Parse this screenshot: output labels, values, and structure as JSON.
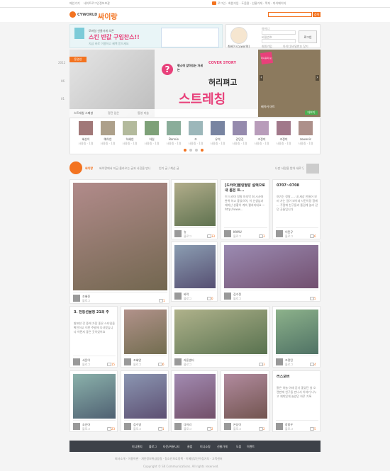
{
  "topbar": {
    "left_links": [
      "메인가기",
      "네이트로그인정보보관"
    ],
    "right_text": "로그인 · 회원가입 · 도움말 · 선물가게 · 쪽지 · 마이페이지"
  },
  "header": {
    "logo_text": "CYWORLD",
    "sub_logo": "싸이랑",
    "search_btn": "검색",
    "search_placeholder": ""
  },
  "banner": {
    "small_text": "모바일 선물가게 오픈",
    "headline": "스킨 반값 구입찬스!!",
    "note": "지금 바로 이용하고 혜택 받으세요"
  },
  "profile": {
    "name": "최싸이 (cyworld)",
    "login_btn": "로그인",
    "id_label": "아이디",
    "pw_label": "비밀번호",
    "join": "회원가입",
    "find": "아이디/비밀번호 찾기"
  },
  "hero": {
    "tag": "동영상",
    "badge": "미니홈피 뉴스",
    "caption": "평소에 앉아있는 자세는",
    "title_small": "COVER STORY",
    "title_1": "허리펴고",
    "title_2": "스트레칭",
    "tabs": [
      "스트레칭 스페셜",
      "정전 입은",
      "통영 미술"
    ],
    "side_title": "베이커 마트",
    "side_more": "더보기"
  },
  "years": [
    "2012",
    "06",
    "01"
  ],
  "friends": [
    {
      "name": "혜성이",
      "sub": "사용중 · 1명"
    },
    {
      "name": "예하연",
      "sub": "사용중 · 1명"
    },
    {
      "name": "하혜연",
      "sub": "사용중 · 1명"
    },
    {
      "name": "하일",
      "sub": "사용중 · 1명"
    },
    {
      "name": "Bonnie",
      "sub": "사용중 · 1명"
    },
    {
      "name": "조",
      "sub": "사용중 · 1명"
    },
    {
      "name": "유석",
      "sub": "사용중 · 1명"
    },
    {
      "name": "강민진",
      "sub": "사용중 · 1명"
    },
    {
      "name": "조정미",
      "sub": "사용중 · 1명"
    },
    {
      "name": "조정미",
      "sub": "사용중 · 1명"
    },
    {
      "name": "zowenic",
      "sub": "사용중 · 1명"
    }
  ],
  "feed_header": {
    "label": "싸이랑",
    "desc": "싸이랑에서 지금 올라오는 글과 사진을 만나보세요.",
    "tab": "인기 글 / 최신 글",
    "right": "나만 사랑을 받아 새로 맞춤미래 콘텐츠들"
  },
  "cards": [
    {
      "name": "조혜진",
      "cat": "블로그",
      "cnt": "1",
      "title": "",
      "body": ""
    },
    {
      "name": "슈",
      "cat": "블로그",
      "cnt": "33",
      "title": "",
      "body": ""
    },
    {
      "name": "KAMU",
      "cat": "블로그",
      "cnt": "3",
      "title": "[드라마]팔랑팔랑 설렉으로 내 몸은 트...",
      "body": "이 드라마 정말 마지막 회 시사에 완벽 하고 좋았으며, 이 선생님과 재미난 상황이 계속 펼쳐지네요 ~ http://www..."
    },
    {
      "name": "이민규",
      "cat": "블로그",
      "cnt": "6",
      "title": "0707~0708",
      "body": "여기는 정말..... 내 세상 만들어 보러 가는 길이 보이네 사진이랑 함께 ... 주말에 친구들과 즐겁게 놀러 갔던 곳들입니다"
    },
    {
      "name": "바락",
      "cat": "블로그",
      "cnt": "0",
      "title": "",
      "body": ""
    },
    {
      "name": "김수정",
      "cat": "블로그",
      "cnt": "5",
      "title": "",
      "body": ""
    },
    {
      "name": "서윤이",
      "cat": "블로그",
      "cnt": "15",
      "title": "3. 전통선물정 21회 주",
      "body": "발표한 것 중에 가장 좋은 스타일을 확인하고 이번 주말에 다녀왔습니다 어쩐지 좋은 곳이었어요"
    },
    {
      "name": "조혜연",
      "cat": "블로그",
      "cnt": "6",
      "title": "",
      "body": ""
    },
    {
      "name": "라론센터",
      "cat": "블로그",
      "cnt": "3",
      "title": "",
      "body": ""
    },
    {
      "name": "조정민",
      "cat": "블로그",
      "cnt": "4",
      "title": "",
      "body": ""
    },
    {
      "name": "조선아",
      "cat": "블로그",
      "cnt": "23",
      "title": "",
      "body": ""
    },
    {
      "name": "김수영",
      "cat": "블로그",
      "cnt": "1",
      "title": "",
      "body": ""
    },
    {
      "name": "다이리",
      "cat": "블로그",
      "cnt": "2",
      "title": "",
      "body": ""
    },
    {
      "name": "은상이",
      "cat": "블로그",
      "cnt": "2",
      "title": "",
      "body": ""
    },
    {
      "name": "장창우",
      "cat": "블로그",
      "cnt": "5",
      "title": "러스모버",
      "body": "맑은 하늘 아래 걷기 좋았던 날 오랜만에 친구들 만나서 이야기 나누고 재미있게 놀았던 하루 기록"
    }
  ],
  "footer": {
    "nav": [
      "미니홈피",
      "블로그",
      "타운/커뮤니티",
      "클럽",
      "미니쇼핑",
      "선물가게",
      "도움",
      "이벤트"
    ],
    "links": "회사소개 · 이용약관 · 개인정보취급방침 · 청소년보호정책 · 이메일무단수집거부 · 고객센터",
    "copy": "Copyright © SK Communications. All rights reserved."
  }
}
